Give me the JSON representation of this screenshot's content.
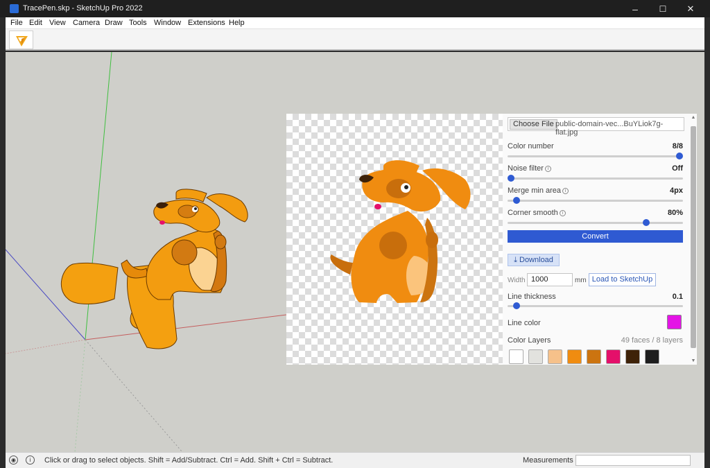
{
  "window": {
    "title": "TracePen.skp - SketchUp Pro 2022",
    "minimize": "–",
    "maximize": "☐",
    "close": "✕"
  },
  "menu": [
    "File",
    "Edit",
    "View",
    "Camera",
    "Draw",
    "Tools",
    "Window",
    "Extensions",
    "Help"
  ],
  "toolbar": {
    "tool_icon": "tracepen-icon"
  },
  "panel": {
    "file": {
      "button": "Choose File",
      "name": "public-domain-vec...BuYLiok7g-flat.jpg"
    },
    "sliders": [
      {
        "label": "Color number",
        "value": "8/8",
        "fraction": 1.0,
        "info": false
      },
      {
        "label": "Noise filter",
        "value": "Off",
        "fraction": 0.0,
        "info": true
      },
      {
        "label": "Merge min area",
        "value": "4px",
        "fraction": 0.05,
        "info": true
      },
      {
        "label": "Corner smooth",
        "value": "80%",
        "fraction": 0.79,
        "info": true
      }
    ],
    "convert": "Convert",
    "download": "Download",
    "width_label": "Width",
    "width_value": "1000",
    "unit": "mm",
    "load": "Load to SketchUp",
    "line_thickness": {
      "label": "Line thickness",
      "value": "0.1",
      "fraction": 0.05
    },
    "line_color": {
      "label": "Line color",
      "color": "#e414e6"
    },
    "color_layers": {
      "label": "Color Layers",
      "info": "49 faces / 8 layers"
    },
    "swatches": [
      "#ffffff",
      "#e2e2de",
      "#f6c18a",
      "#f08c10",
      "#cc7410",
      "#e4106a",
      "#3e2208",
      "#1e1e1e"
    ]
  },
  "status": {
    "message": "Click or drag to select objects. Shift = Add/Subtract. Ctrl = Add. Shift + Ctrl = Subtract.",
    "measurements_label": "Measurements",
    "measurements_value": ""
  }
}
